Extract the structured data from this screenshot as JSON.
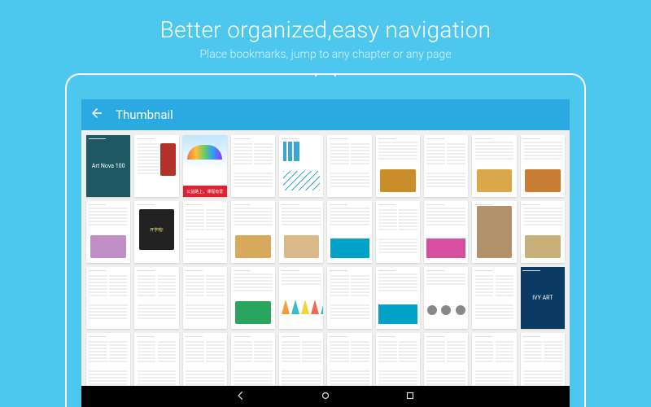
{
  "hero": {
    "headline": "Better organized,easy navigation",
    "subhead": "Place bookmarks,  jump to any chapter or any page"
  },
  "app": {
    "topbar_title": "Thumbnail"
  },
  "thumbnails": [
    {
      "kind": "cover_dark",
      "title": "Art Nova 100",
      "accent": "#1e5963"
    },
    {
      "kind": "text_photo",
      "accent": "#b3332b"
    },
    {
      "kind": "illustration",
      "accent": "#ffbe3a",
      "banner": "公益路上，课程有爱"
    },
    {
      "kind": "text_columns"
    },
    {
      "kind": "charts",
      "accent": "#3aa6d1"
    },
    {
      "kind": "text_columns"
    },
    {
      "kind": "text_image",
      "accent": "#c98d2a"
    },
    {
      "kind": "text_columns"
    },
    {
      "kind": "text_image",
      "accent": "#d8a84b"
    },
    {
      "kind": "text_image",
      "accent": "#c97e36"
    },
    {
      "kind": "text_image",
      "accent": "#bf8fc6"
    },
    {
      "kind": "chalkboard",
      "accent": "#1c1c1c"
    },
    {
      "kind": "text_columns"
    },
    {
      "kind": "text_image",
      "accent": "#d6a95b"
    },
    {
      "kind": "text_image",
      "accent": "#d9b98a"
    },
    {
      "kind": "text_block",
      "accent": "#00a3c7"
    },
    {
      "kind": "text_columns"
    },
    {
      "kind": "text_block",
      "accent": "#d64fa0"
    },
    {
      "kind": "photo_full",
      "accent": "#b3926b"
    },
    {
      "kind": "text_image",
      "accent": "#c9b07a"
    },
    {
      "kind": "text_columns"
    },
    {
      "kind": "text_columns"
    },
    {
      "kind": "text_columns"
    },
    {
      "kind": "text_image",
      "accent": "#2aa560"
    },
    {
      "kind": "triangles",
      "accent": "#f29b3a"
    },
    {
      "kind": "text_columns"
    },
    {
      "kind": "text_block",
      "accent": "#00a3c7"
    },
    {
      "kind": "avatars"
    },
    {
      "kind": "text_columns"
    },
    {
      "kind": "cover_dark",
      "title": "IVY ART",
      "accent": "#0b3a63"
    },
    {
      "kind": "text_columns"
    },
    {
      "kind": "text_columns"
    },
    {
      "kind": "text_columns"
    },
    {
      "kind": "text_columns"
    },
    {
      "kind": "text_columns"
    },
    {
      "kind": "text_columns"
    },
    {
      "kind": "text_columns"
    },
    {
      "kind": "text_columns"
    },
    {
      "kind": "text_columns"
    },
    {
      "kind": "text_columns"
    }
  ]
}
